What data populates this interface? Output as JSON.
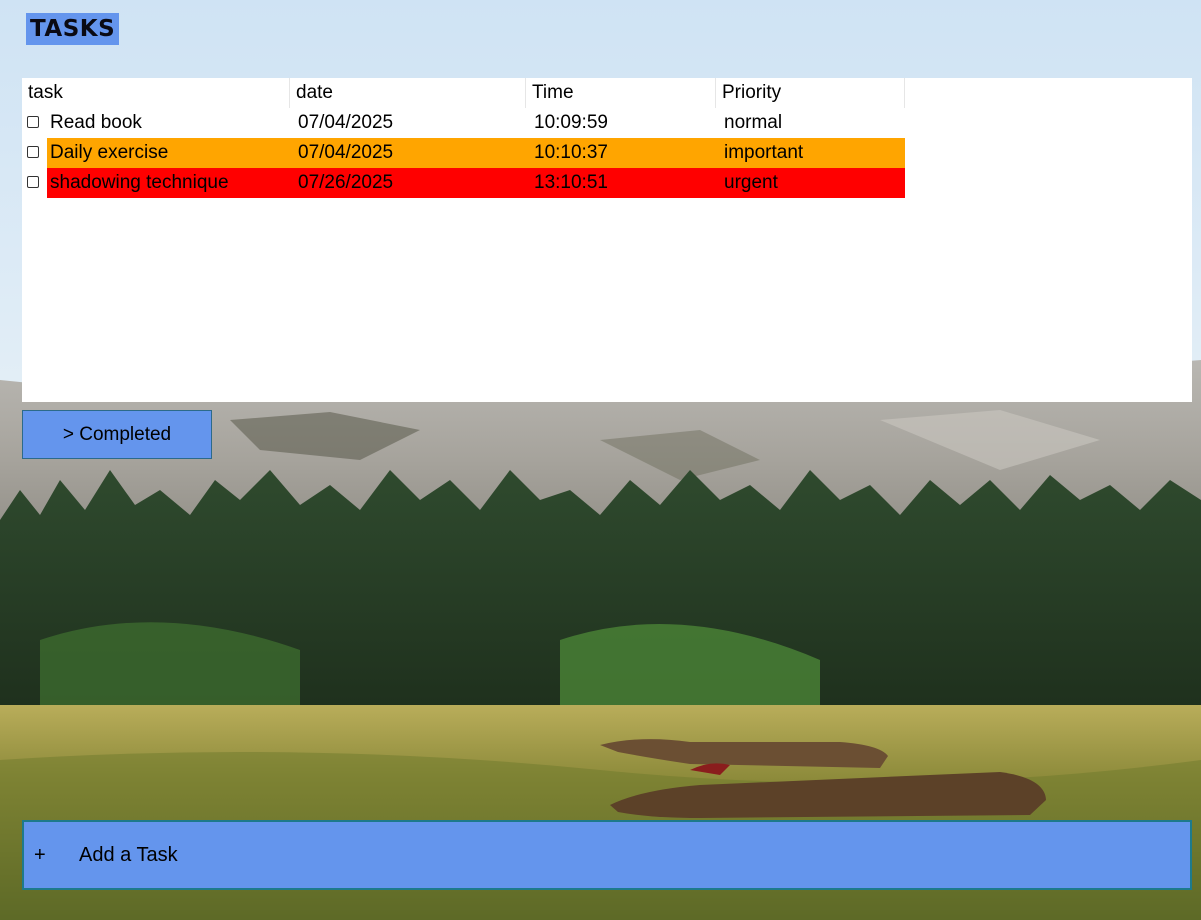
{
  "app": {
    "title": "TASKS"
  },
  "colors": {
    "accent": "#6495ed",
    "important": "#ffa500",
    "urgent": "#ff0000",
    "normal": "#ffffff"
  },
  "task_list": {
    "columns": [
      "task",
      "date",
      "Time",
      "Priority"
    ],
    "rows": [
      {
        "checked": false,
        "task": "Read book",
        "date": "07/04/2025",
        "time": "10:09:59",
        "priority": "normal",
        "highlight": "#ffffff"
      },
      {
        "checked": false,
        "task": "Daily exercise",
        "date": "07/04/2025",
        "time": "10:10:37",
        "priority": "important",
        "highlight": "#ffa500"
      },
      {
        "checked": false,
        "task": "shadowing technique",
        "date": "07/26/2025",
        "time": "13:10:51",
        "priority": "urgent",
        "highlight": "#ff0000"
      }
    ]
  },
  "completed_button": {
    "label": "> Completed"
  },
  "add_task": {
    "icon": "plus-icon",
    "plus_glyph": "+",
    "label": "Add a Task"
  }
}
